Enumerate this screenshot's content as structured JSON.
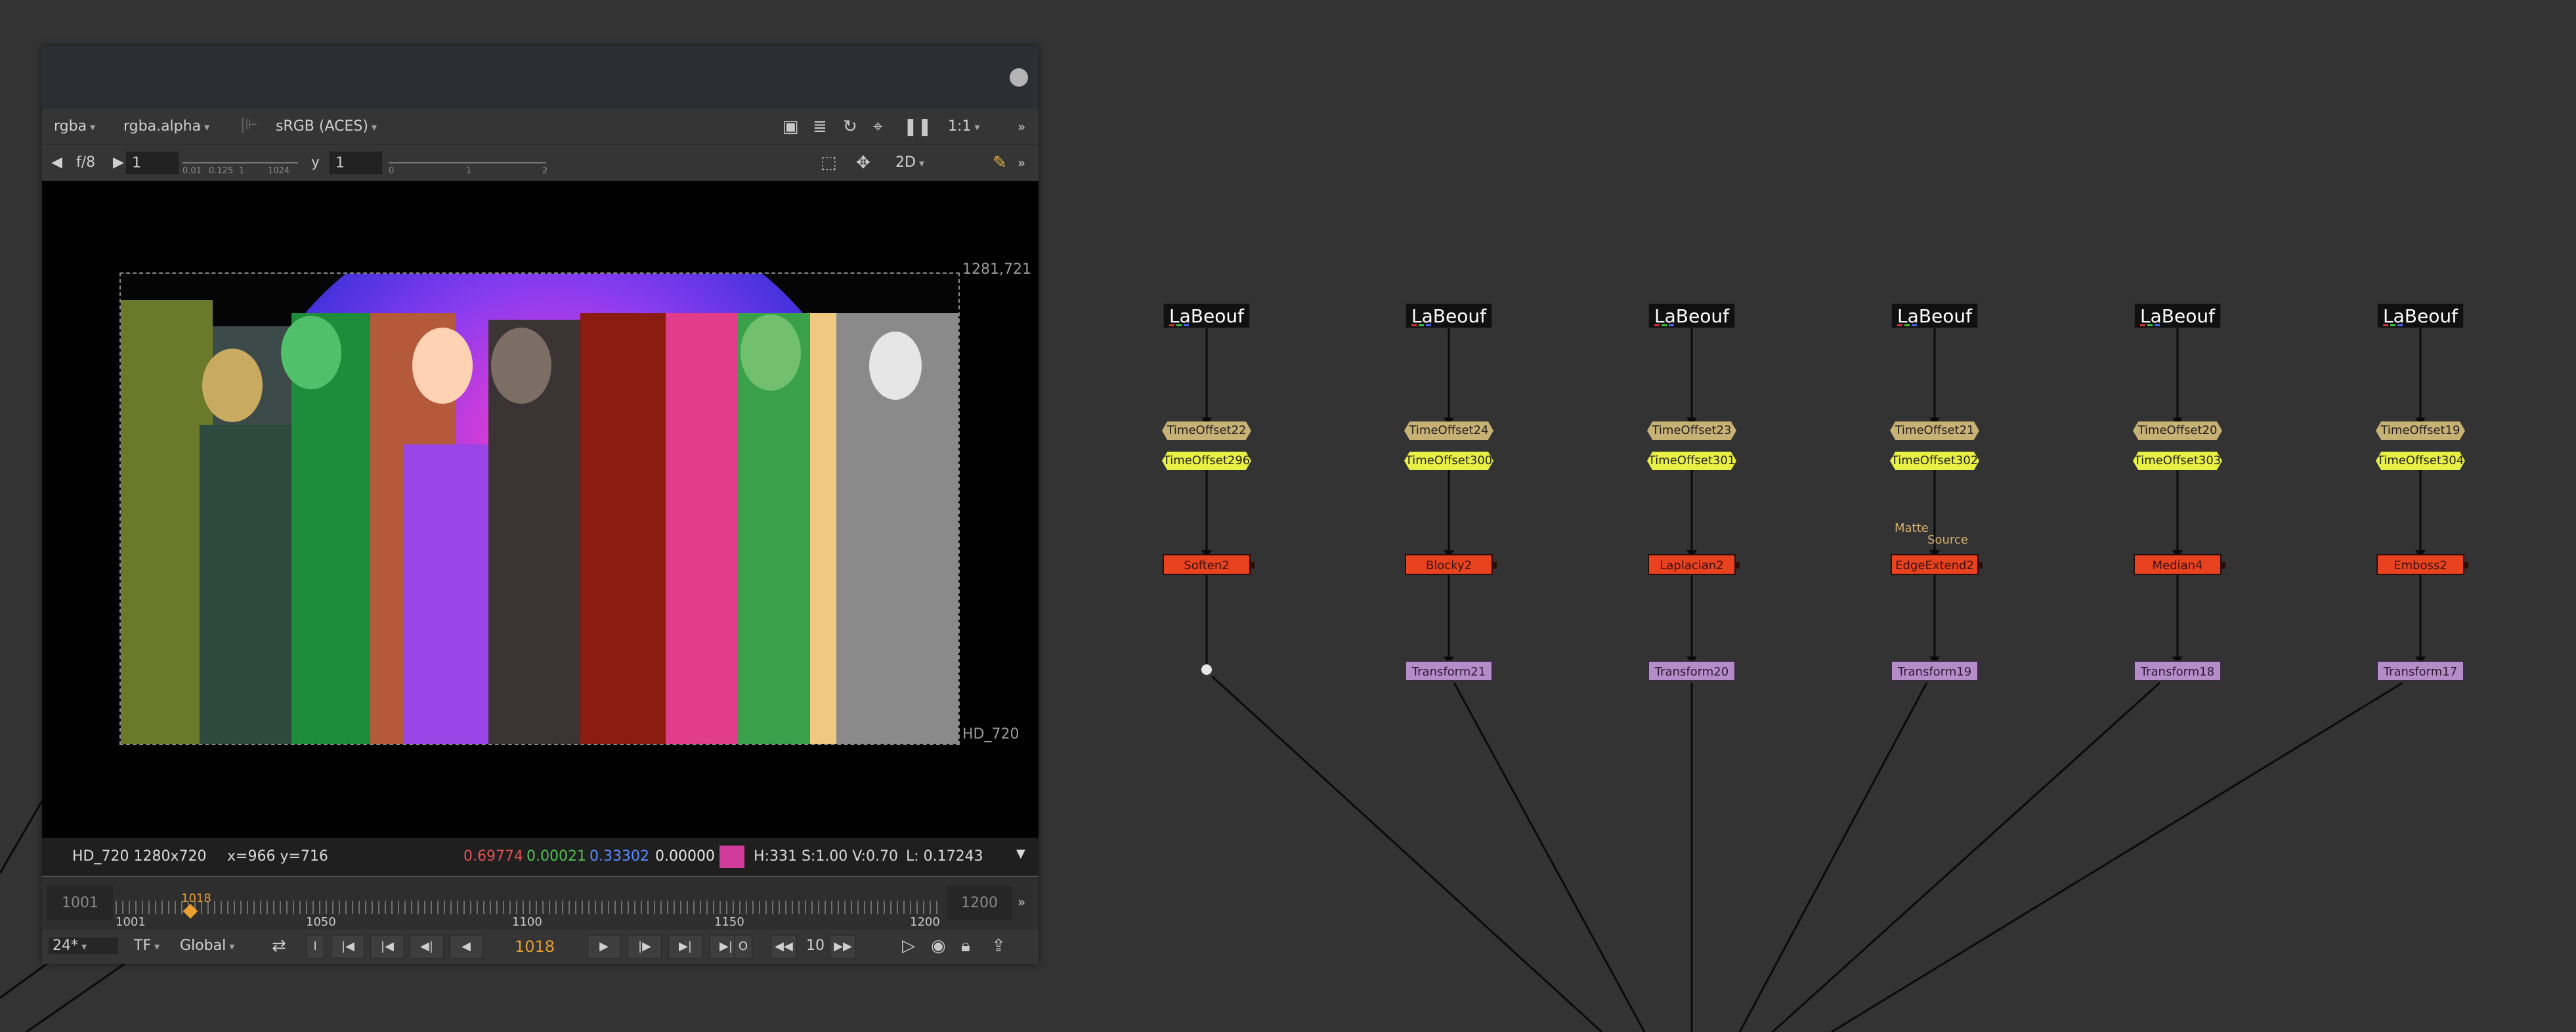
{
  "viewer": {
    "channels": "rgba",
    "alpha_channel": "rgba.alpha",
    "colorspace": "sRGB (ACES)",
    "zoom": "1:1",
    "fstop": "f/8",
    "frame_input": "1",
    "gain_ticks": [
      "0.01",
      "0.125",
      "1",
      "1024"
    ],
    "gamma_label": "y",
    "gamma_input": "1",
    "gamma_ticks": [
      "0",
      "1",
      "2"
    ],
    "view_mode": "2D",
    "bbox_label": "1281,721",
    "format_label": "HD_720",
    "info": {
      "format": "HD_720 1280x720",
      "coords": "x=966 y=716",
      "r": "0.69774",
      "g": "0.00021",
      "b": "0.33302",
      "a": "0.00000",
      "swatch_color": "#d13a9a",
      "hsv": "H:331 S:1.00 V:0.70",
      "luma": "L: 0.17243"
    },
    "timeline": {
      "start": "1001",
      "end": "1200",
      "current": "1018",
      "labels": [
        "1001",
        "1050",
        "1100",
        "1150",
        "1200"
      ]
    },
    "transport": {
      "fps": "24*",
      "tf": "TF",
      "scope": "Global",
      "frame": "1018",
      "step": "10"
    }
  },
  "graph": {
    "columns": [
      {
        "read": "LaBeouf",
        "offset_a": "TimeOffset22",
        "offset_b": "TimeOffset296",
        "effect": "Soften2",
        "transform": ""
      },
      {
        "read": "LaBeouf",
        "offset_a": "TimeOffset24",
        "offset_b": "TimeOffset300",
        "effect": "Blocky2",
        "transform": "Transform21"
      },
      {
        "read": "LaBeouf",
        "offset_a": "TimeOffset23",
        "offset_b": "TimeOffset301",
        "effect": "Laplacian2",
        "transform": "Transform20"
      },
      {
        "read": "LaBeouf",
        "offset_a": "TimeOffset21",
        "offset_b": "TimeOffset302",
        "effect": "EdgeExtend2",
        "transform": "Transform19"
      },
      {
        "read": "LaBeouf",
        "offset_a": "TimeOffset20",
        "offset_b": "TimeOffset303",
        "effect": "Median4",
        "transform": "Transform18"
      },
      {
        "read": "LaBeouf",
        "offset_a": "TimeOffset19",
        "offset_b": "TimeOffset304",
        "effect": "Emboss2",
        "transform": "Transform17"
      }
    ],
    "pipe_labels": {
      "matte": "Matte",
      "source": "Source"
    }
  },
  "colors": {
    "background": "#333333",
    "effect_node": "#e8421e",
    "transform_node": "#b48cc8",
    "timeoffset_a": "#c8b174",
    "timeoffset_b": "#e8f044",
    "current_frame": "#e8a030"
  }
}
